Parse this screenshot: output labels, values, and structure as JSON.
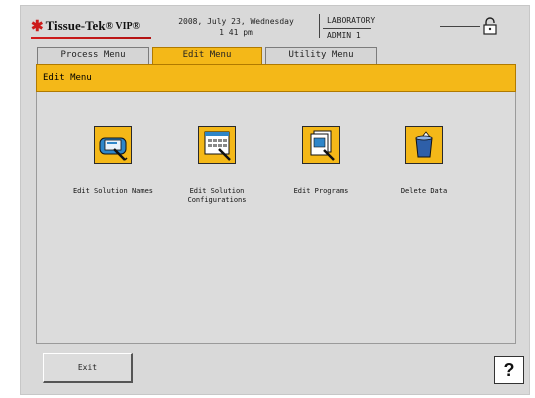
{
  "header": {
    "brand": "Tissue-Tek",
    "brand_suffix": "® VIP®",
    "date_line": "2008, July 23, Wednesday",
    "time_line": "1 41 pm",
    "location": "LABORATORY",
    "user": "ADMIN 1",
    "lock_icon": "padlock-icon"
  },
  "tabs": [
    {
      "label": "Process Menu"
    },
    {
      "label": "Edit Menu",
      "active": true
    },
    {
      "label": "Utility Menu"
    }
  ],
  "title": "Edit Menu",
  "menu_items": [
    {
      "label": "Edit Solution Names",
      "icon": "solution-names-icon"
    },
    {
      "label_line1": "Edit Solution",
      "label_line2": "Configurations",
      "icon": "solution-configurations-icon"
    },
    {
      "label": "Edit Programs",
      "icon": "programs-icon"
    },
    {
      "label": "Delete Data",
      "icon": "trash-can-icon"
    }
  ],
  "footer": {
    "exit_label": "Exit",
    "help_label": "?"
  },
  "colors": {
    "accent": "#f4b818",
    "accent_border": "#b07a00",
    "panel": "#dcdcdc",
    "brand_red": "#cc1b1b"
  }
}
